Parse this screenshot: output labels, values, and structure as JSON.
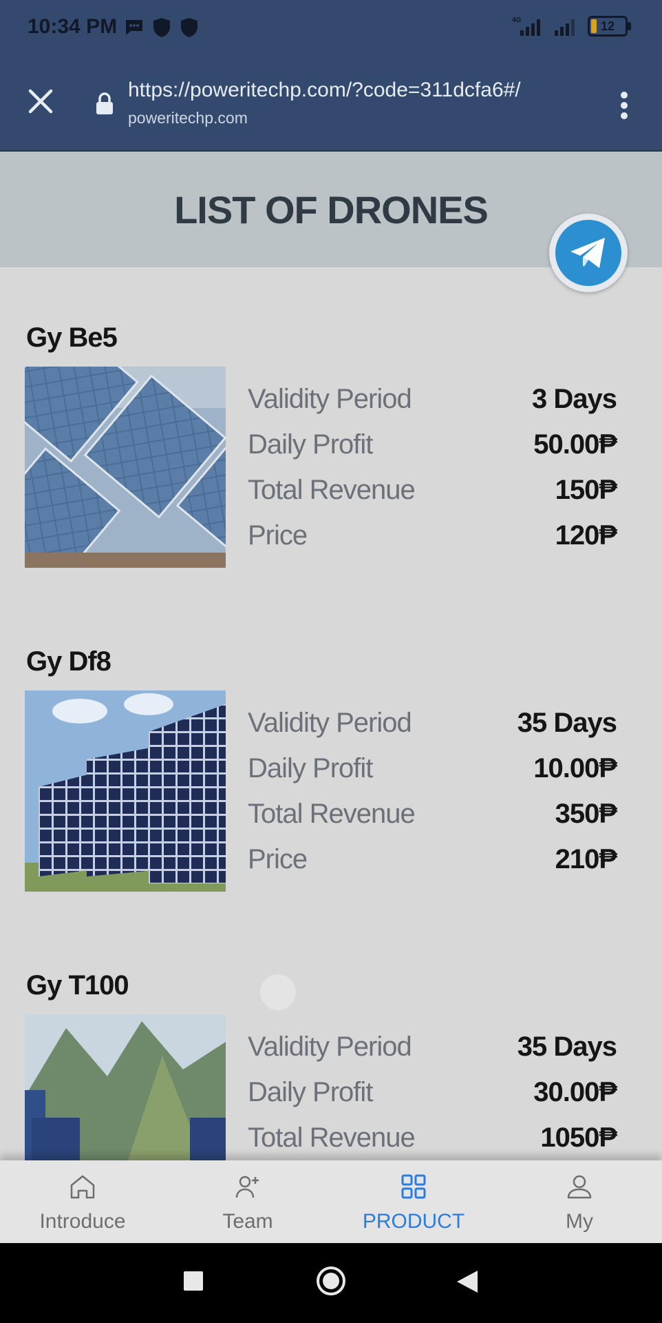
{
  "status": {
    "time": "10:34 PM",
    "network": "4G",
    "battery": "12"
  },
  "browser": {
    "url": "https://poweritechp.com/?code=311dcfa6#/",
    "domain": "poweritechp.com"
  },
  "page": {
    "title": "LIST OF DRONES"
  },
  "products": [
    {
      "name": "Gy Be5",
      "rows": [
        {
          "label": "Validity Period",
          "value": "3 Days"
        },
        {
          "label": "Daily Profit",
          "value": "50.00₱"
        },
        {
          "label": "Total Revenue",
          "value": "150₱"
        },
        {
          "label": "Price",
          "value": "120₱"
        }
      ]
    },
    {
      "name": "Gy Df8",
      "rows": [
        {
          "label": "Validity Period",
          "value": "35 Days"
        },
        {
          "label": "Daily Profit",
          "value": "10.00₱"
        },
        {
          "label": "Total Revenue",
          "value": "350₱"
        },
        {
          "label": "Price",
          "value": "210₱"
        }
      ]
    },
    {
      "name": "Gy T100",
      "rows": [
        {
          "label": "Validity Period",
          "value": "35 Days"
        },
        {
          "label": "Daily Profit",
          "value": "30.00₱"
        },
        {
          "label": "Total Revenue",
          "value": "1050₱"
        }
      ]
    }
  ],
  "tabs": [
    {
      "label": "Introduce",
      "icon": "home-icon"
    },
    {
      "label": "Team",
      "icon": "add-person-icon"
    },
    {
      "label": "PRODUCT",
      "icon": "grid-icon",
      "active": true
    },
    {
      "label": "My",
      "icon": "user-icon"
    }
  ],
  "colors": {
    "header_bar": "#334a6e",
    "title_band": "#bcc3c6",
    "active_tab": "#2a7de0",
    "telegram": "#2b8fd0"
  }
}
